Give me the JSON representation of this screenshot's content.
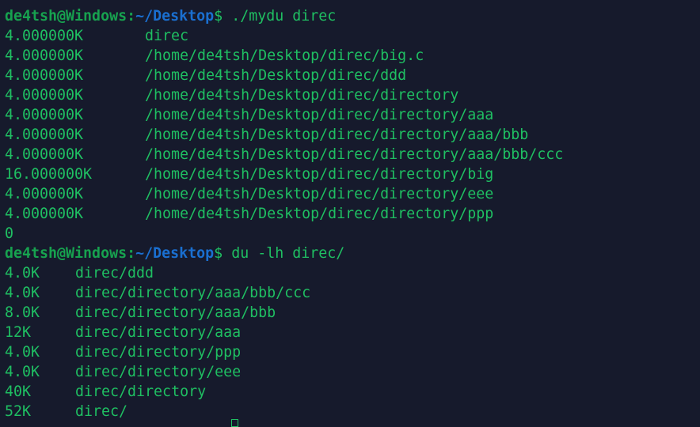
{
  "colors": {
    "background": "#161a2c",
    "text": "#1fbf62",
    "prompt_user": "#17a24f",
    "prompt_path": "#1a6fd0"
  },
  "commands": [
    {
      "user": "de4tsh@Windows",
      "path": "~/Desktop",
      "symbol": "$",
      "command": " ./mydu direc"
    },
    {
      "user": "de4tsh@Windows",
      "path": "~/Desktop",
      "symbol": "$",
      "command": " du -lh direc/"
    }
  ],
  "mydu_output": [
    {
      "size": "4.000000K",
      "path": "direc"
    },
    {
      "size": "4.000000K",
      "path": "/home/de4tsh/Desktop/direc/big.c"
    },
    {
      "size": "4.000000K",
      "path": "/home/de4tsh/Desktop/direc/ddd"
    },
    {
      "size": "4.000000K",
      "path": "/home/de4tsh/Desktop/direc/directory"
    },
    {
      "size": "4.000000K",
      "path": "/home/de4tsh/Desktop/direc/directory/aaa"
    },
    {
      "size": "4.000000K",
      "path": "/home/de4tsh/Desktop/direc/directory/aaa/bbb"
    },
    {
      "size": "4.000000K",
      "path": "/home/de4tsh/Desktop/direc/directory/aaa/bbb/ccc"
    },
    {
      "size": "16.000000K",
      "path": "/home/de4tsh/Desktop/direc/directory/big"
    },
    {
      "size": "4.000000K",
      "path": "/home/de4tsh/Desktop/direc/directory/eee"
    },
    {
      "size": "4.000000K",
      "path": "/home/de4tsh/Desktop/direc/directory/ppp"
    }
  ],
  "mydu_return": "0",
  "du_output": [
    {
      "size": "4.0K",
      "path": "direc/ddd"
    },
    {
      "size": "4.0K",
      "path": "direc/directory/aaa/bbb/ccc"
    },
    {
      "size": "8.0K",
      "path": "direc/directory/aaa/bbb"
    },
    {
      "size": "12K",
      "path": "direc/directory/aaa"
    },
    {
      "size": "4.0K",
      "path": "direc/directory/ppp"
    },
    {
      "size": "4.0K",
      "path": "direc/directory/eee"
    },
    {
      "size": "40K",
      "path": "direc/directory"
    },
    {
      "size": "52K",
      "path": "direc/"
    }
  ]
}
